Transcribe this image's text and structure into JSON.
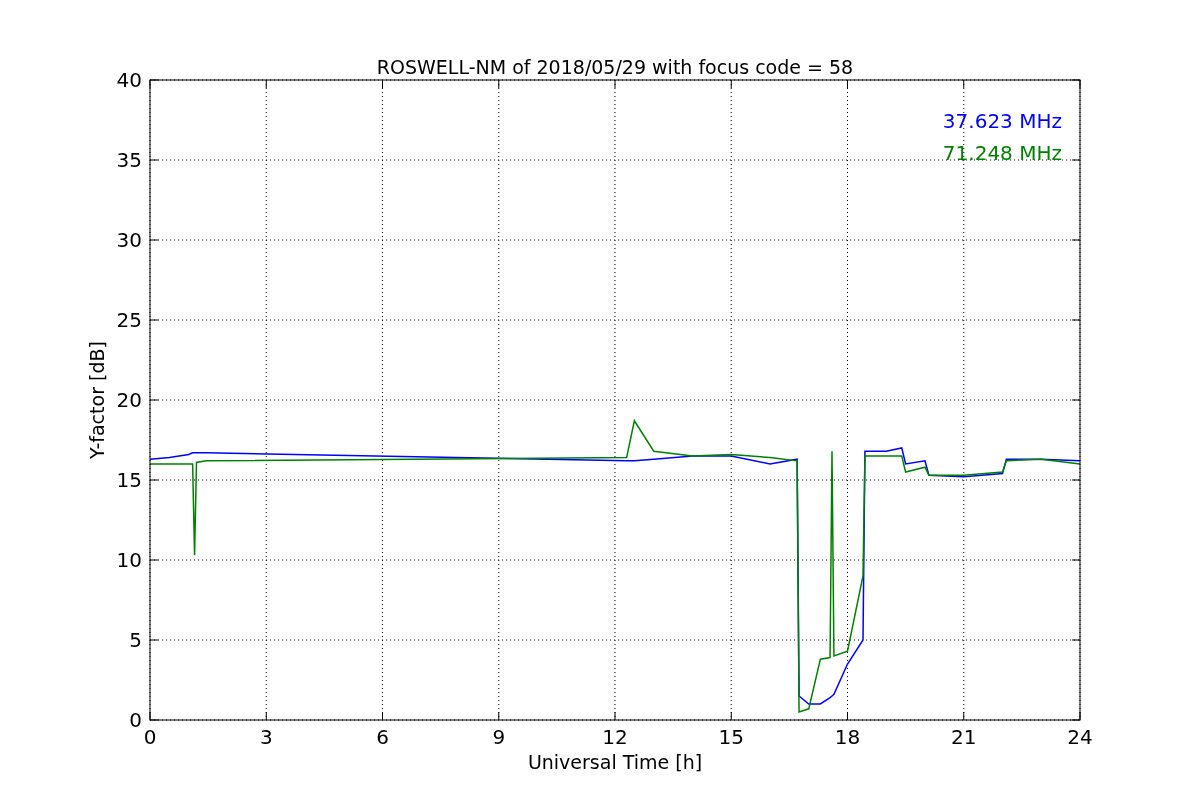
{
  "figure": {
    "chart_data": {
      "type": "line",
      "title": "ROSWELL-NM of 2018/05/29 with focus code = 58",
      "xlabel": "Universal Time [h]",
      "ylabel": "Y-factor [dB]",
      "grid": true,
      "x": [
        0,
        0.5,
        1,
        1.1,
        1.15,
        1.2,
        1.45,
        12.3,
        12.5,
        13,
        14,
        15,
        16,
        16.7,
        16.75,
        17,
        17.3,
        17.55,
        17.6,
        17.65,
        18,
        18.4,
        18.45,
        19,
        19.4,
        19.5,
        20,
        20.1,
        21,
        22,
        22.1,
        23,
        24
      ],
      "series": [
        {
          "name": "37.623 MHz",
          "color": "#0000ff",
          "values": [
            16.3,
            16.4,
            16.6,
            16.7,
            16.7,
            16.7,
            16.7,
            16.2,
            16.2,
            16.3,
            16.5,
            16.5,
            16.0,
            16.3,
            1.5,
            1.0,
            1.0,
            1.4,
            1.5,
            1.6,
            3.5,
            5.0,
            16.8,
            16.8,
            17.0,
            16.0,
            16.2,
            15.3,
            15.2,
            15.4,
            16.3,
            16.3,
            16.2
          ]
        },
        {
          "name": "71.248 MHz",
          "color": "#008000",
          "values": [
            16.0,
            16.0,
            16.0,
            16.0,
            10.3,
            16.1,
            16.2,
            16.4,
            18.7,
            16.8,
            16.5,
            16.6,
            16.4,
            16.2,
            0.5,
            0.7,
            3.8,
            3.9,
            16.8,
            4.0,
            4.3,
            9.0,
            16.5,
            16.5,
            16.5,
            15.5,
            15.8,
            15.3,
            15.3,
            15.5,
            16.2,
            16.3,
            16.0
          ]
        }
      ],
      "xlim": [
        0,
        24
      ],
      "ylim": [
        0,
        40
      ],
      "xticks": [
        0,
        3,
        6,
        9,
        12,
        15,
        18,
        21,
        24
      ],
      "yticks": [
        0,
        5,
        10,
        15,
        20,
        25,
        30,
        35,
        40
      ]
    }
  }
}
